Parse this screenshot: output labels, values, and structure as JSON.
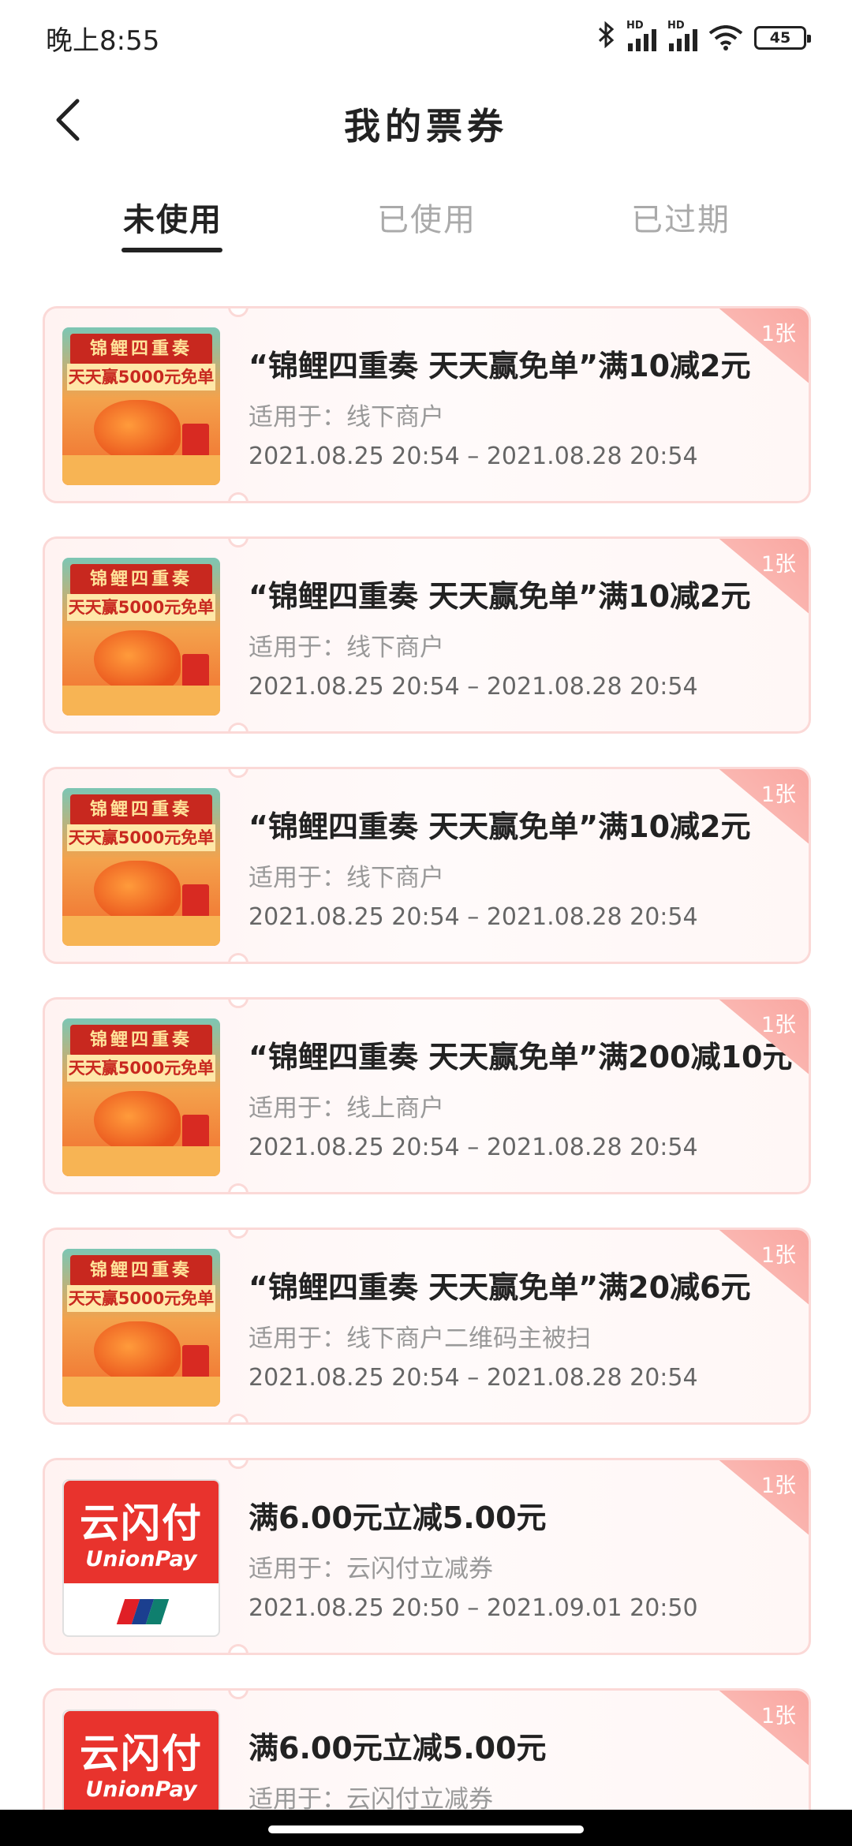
{
  "status_bar": {
    "time": "晚上8:55",
    "signal1_label": "HD",
    "signal2_label": "HD",
    "battery": "45",
    "icons": [
      "bluetooth-icon",
      "signal-icon",
      "signal-icon",
      "wifi-icon",
      "battery-icon"
    ]
  },
  "header": {
    "title": "我的票券",
    "back_icon": "chevron-left-icon"
  },
  "tabs": [
    {
      "label": "未使用",
      "active": true
    },
    {
      "label": "已使用",
      "active": false
    },
    {
      "label": "已过期",
      "active": false
    }
  ],
  "coupons": [
    {
      "thumb": "koi",
      "title": "“锦鲤四重奏 天天赢免单”满10减2元",
      "scope": "适用于：线下商户",
      "date": "2021.08.25 20:54 – 2021.08.28 20:54",
      "count": "1张"
    },
    {
      "thumb": "koi",
      "title": "“锦鲤四重奏 天天赢免单”满10减2元",
      "scope": "适用于：线下商户",
      "date": "2021.08.25 20:54 – 2021.08.28 20:54",
      "count": "1张"
    },
    {
      "thumb": "koi",
      "title": "“锦鲤四重奏 天天赢免单”满10减2元",
      "scope": "适用于：线下商户",
      "date": "2021.08.25 20:54 – 2021.08.28 20:54",
      "count": "1张"
    },
    {
      "thumb": "koi",
      "title": "“锦鲤四重奏 天天赢免单”满200减10元",
      "scope": "适用于：线上商户",
      "date": "2021.08.25 20:54 – 2021.08.28 20:54",
      "count": "1张"
    },
    {
      "thumb": "koi",
      "title": "“锦鲤四重奏 天天赢免单”满20减6元",
      "scope": "适用于：线下商户二维码主被扫",
      "date": "2021.08.25 20:54 – 2021.08.28 20:54",
      "count": "1张"
    },
    {
      "thumb": "unionpay",
      "title": "满6.00元立减5.00元",
      "scope": "适用于：云闪付立减券",
      "date": "2021.08.25 20:50 – 2021.09.01 20:50",
      "count": "1张"
    },
    {
      "thumb": "unionpay",
      "title": "满6.00元立减5.00元",
      "scope": "适用于：云闪付立减券",
      "date": "",
      "count": "1张"
    }
  ],
  "thumbs": {
    "koi": {
      "line1": "锦鲤四重奏",
      "line2": "天天赢5000元免单"
    },
    "unionpay": {
      "name": "云闪付",
      "sub": "UnionPay"
    }
  },
  "colors": {
    "accent": "#e8332d",
    "card_border": "#fbd9d7",
    "badge": "#f9a6a0",
    "unionpay_red": "#e01f26",
    "unionpay_blue": "#1b3f8f",
    "unionpay_green": "#0f7f6e"
  }
}
